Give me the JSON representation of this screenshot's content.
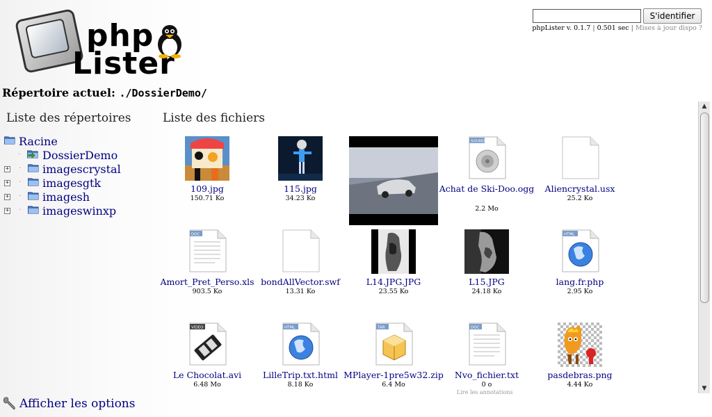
{
  "app": {
    "logo_text_top": "php",
    "logo_text_bottom": "Lister"
  },
  "header": {
    "login_value": "",
    "login_button_label": "S'identifier",
    "version_text": "phpLister v. 0.1.7",
    "timing_text": "0.501 sec",
    "separator": "|",
    "update_link": "Mises à jour dispo ?"
  },
  "current_dir": {
    "label": "Répertoire actuel:",
    "path": "./DossierDemo/"
  },
  "tree": {
    "heading": "Liste des répertoires",
    "root_label": "Racine",
    "items": [
      {
        "label": "DossierDemo",
        "expander": ""
      },
      {
        "label": "imagescrystal",
        "expander": "+"
      },
      {
        "label": "imagesgtk",
        "expander": "+"
      },
      {
        "label": "imagesh",
        "expander": "+"
      },
      {
        "label": "imageswinxp",
        "expander": "+"
      }
    ]
  },
  "files": {
    "heading": "Liste des fichiers",
    "items": [
      {
        "name": "109.jpg",
        "size": "150.71 Ko",
        "icon": "image-thumbnail"
      },
      {
        "name": "115.jpg",
        "size": "34.23 Ko",
        "icon": "image-thumbnail"
      },
      {
        "name": "",
        "size": "",
        "icon": "image-thumbnail-car"
      },
      {
        "name": "Achat de Ski-Doo.ogg",
        "size": "2.2 Mo",
        "icon": "sound-icon",
        "badge": "SOUND"
      },
      {
        "name": "Aliencrystal.usx",
        "size": "25.2 Ko",
        "icon": "blank-file-icon"
      },
      {
        "name": "Amort_Pret_Perso.xls",
        "size": "903.5 Ko",
        "icon": "doc-file-icon",
        "badge": "DOC"
      },
      {
        "name": "bondAllVector.swf",
        "size": "13.31 Ko",
        "icon": "blank-file-icon"
      },
      {
        "name": "L14.JPG.JPG",
        "size": "23.55 Ko",
        "icon": "image-thumbnail"
      },
      {
        "name": "L15.JPG",
        "size": "24.18 Ko",
        "icon": "image-thumbnail"
      },
      {
        "name": "lang.fr.php",
        "size": "2.95 Ko",
        "icon": "html-file-icon",
        "badge": "HTML"
      },
      {
        "name": "Le Chocolat.avi",
        "size": "6.48 Mo",
        "icon": "video-file-icon",
        "badge": "VIDEO"
      },
      {
        "name": "LilleTrip.txt.html",
        "size": "8.18 Ko",
        "icon": "html-file-icon",
        "badge": "HTML"
      },
      {
        "name": "MPlayer-1pre5w32.zip",
        "size": "6.4 Mo",
        "icon": "archive-file-icon",
        "badge": "TAR"
      },
      {
        "name": "Nvo_fichier.txt",
        "size": "0 o",
        "icon": "doc-file-icon",
        "badge": "DOC"
      },
      {
        "name": "pasdebras.png",
        "size": "4.44 Ko",
        "icon": "image-thumbnail"
      }
    ],
    "partial_caption": "Lire les annotations"
  },
  "footer": {
    "options_label": "Afficher les options"
  },
  "colors": {
    "link": "#000080",
    "badge_blue": "#4a7fd0"
  }
}
